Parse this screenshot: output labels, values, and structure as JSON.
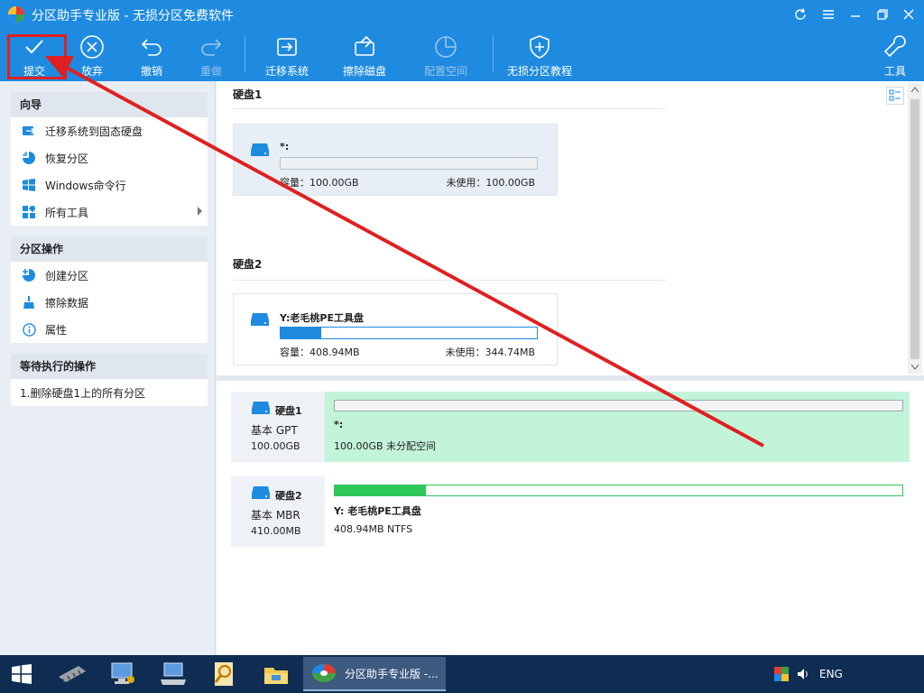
{
  "window": {
    "title": "分区助手专业版 - 无损分区免费软件",
    "brand_color": "#1e8be0",
    "controls": [
      "refresh-icon",
      "menu-icon",
      "minimize-icon",
      "restore-icon",
      "close-icon"
    ]
  },
  "toolbar": {
    "commit_label": "提交",
    "discard_label": "放弃",
    "undo_label": "撤销",
    "redo_label": "重做",
    "migrate_label": "迁移系统",
    "wipe_label": "擦除磁盘",
    "allocate_label": "配置空间",
    "tutorial_label": "无损分区教程",
    "tools_label": "工具",
    "highlight_color": "#e02020"
  },
  "sidebar": {
    "wizard": {
      "title": "向导",
      "items": [
        {
          "label": "迁移系统到固态硬盘",
          "icon": "migrate-icon"
        },
        {
          "label": "恢复分区",
          "icon": "recover-icon"
        },
        {
          "label": "Windows命令行",
          "icon": "windows-icon"
        },
        {
          "label": "所有工具",
          "icon": "tools-grid-icon"
        }
      ]
    },
    "partition_ops": {
      "title": "分区操作",
      "items": [
        {
          "label": "创建分区",
          "icon": "create-partition-icon"
        },
        {
          "label": "擦除数据",
          "icon": "wipe-data-icon"
        },
        {
          "label": "属性",
          "icon": "info-icon"
        }
      ]
    },
    "pending": {
      "title": "等待执行的操作",
      "items": [
        "1.删除硬盘1上的所有分区"
      ]
    }
  },
  "disks_top": [
    {
      "label": "硬盘1",
      "partition": {
        "name": "*:",
        "capacity": "容量：100.00GB",
        "unused": "未使用：100.00GB",
        "used_fraction": 0
      }
    },
    {
      "label": "硬盘2",
      "partition": {
        "name": "Y:老毛桃PE工具盘",
        "capacity": "容量：408.94MB",
        "unused": "未使用：344.74MB",
        "used_fraction": 0.16
      }
    }
  ],
  "disks_bottom": [
    {
      "name": "硬盘1",
      "type": "基本 GPT",
      "size": "100.00GB",
      "partition_name": "*:",
      "partition_detail": "100.00GB 未分配空间",
      "used_fraction": 0,
      "block_color": "#c2f4d9"
    },
    {
      "name": "硬盘2",
      "type": "基本 MBR",
      "size": "410.00MB",
      "partition_name": "Y: 老毛桃PE工具盘",
      "partition_detail": "408.94MB NTFS",
      "used_fraction": 0.16,
      "block_color": "#ffffff"
    }
  ],
  "taskbar": {
    "active_app_label": "分区助手专业版 -...",
    "language": "ENG"
  }
}
